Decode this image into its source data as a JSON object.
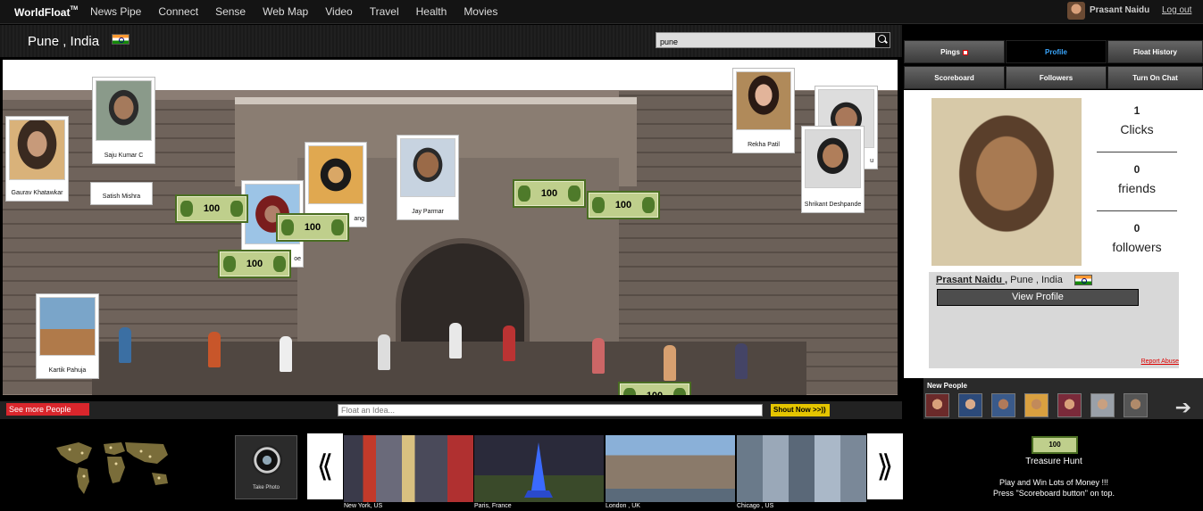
{
  "nav": {
    "logo": "WorldFloat",
    "logo_mark": "TM",
    "items": [
      "News Pipe",
      "Connect",
      "Sense",
      "Web Map",
      "Video",
      "Travel",
      "Health",
      "Movies"
    ],
    "user_name": "Prasant Naidu",
    "logout": "Log out"
  },
  "location": {
    "title": "Pune , India",
    "search_value": "pune"
  },
  "scene": {
    "people": [
      "Gaurav Khatawkar",
      "Saju Kumar C",
      "Satish Mishra",
      "ang",
      "Jay Parmar",
      "Rekha Patil",
      "u",
      "Shrikant Deshpande",
      "Kartik Pahuja",
      "oe"
    ],
    "bill_value": "100"
  },
  "scene_bar": {
    "see_more": "See more People",
    "float_placeholder": "Float an Idea...",
    "shout_label": "Shout Now",
    "shout_arrows": ">>))"
  },
  "right_tabs": {
    "pings": "Pings",
    "profile": "Profile",
    "float_history": "Float History",
    "scoreboard": "Scoreboard",
    "followers": "Followers",
    "chat": "Turn On Chat"
  },
  "profile": {
    "clicks_count": "1",
    "clicks_label": "Clicks",
    "friends_count": "0",
    "friends_label": "friends",
    "followers_count": "0",
    "followers_label": "followers",
    "name": "Prasant Naidu ,",
    "location": " Pune , India",
    "view_profile": "View Profile",
    "report": "Report Abuse"
  },
  "new_people": {
    "label": "New People"
  },
  "bottom": {
    "take_photo": "Take Photo",
    "prev": "⟪",
    "next": "⟫",
    "cities": [
      "New York, US",
      "Paris, France",
      "London , UK",
      "Chicago , US"
    ],
    "treasure_bill": "100",
    "treasure_title": "Treasure Hunt",
    "treasure_line1": "Play and Win Lots of Money !!!",
    "treasure_line2": "Press \"Scoreboard button\" on top."
  },
  "colors": {
    "accent_red": "#d9262c",
    "shout_yellow": "#e5c500",
    "active_tab": "#3aa7ff"
  }
}
